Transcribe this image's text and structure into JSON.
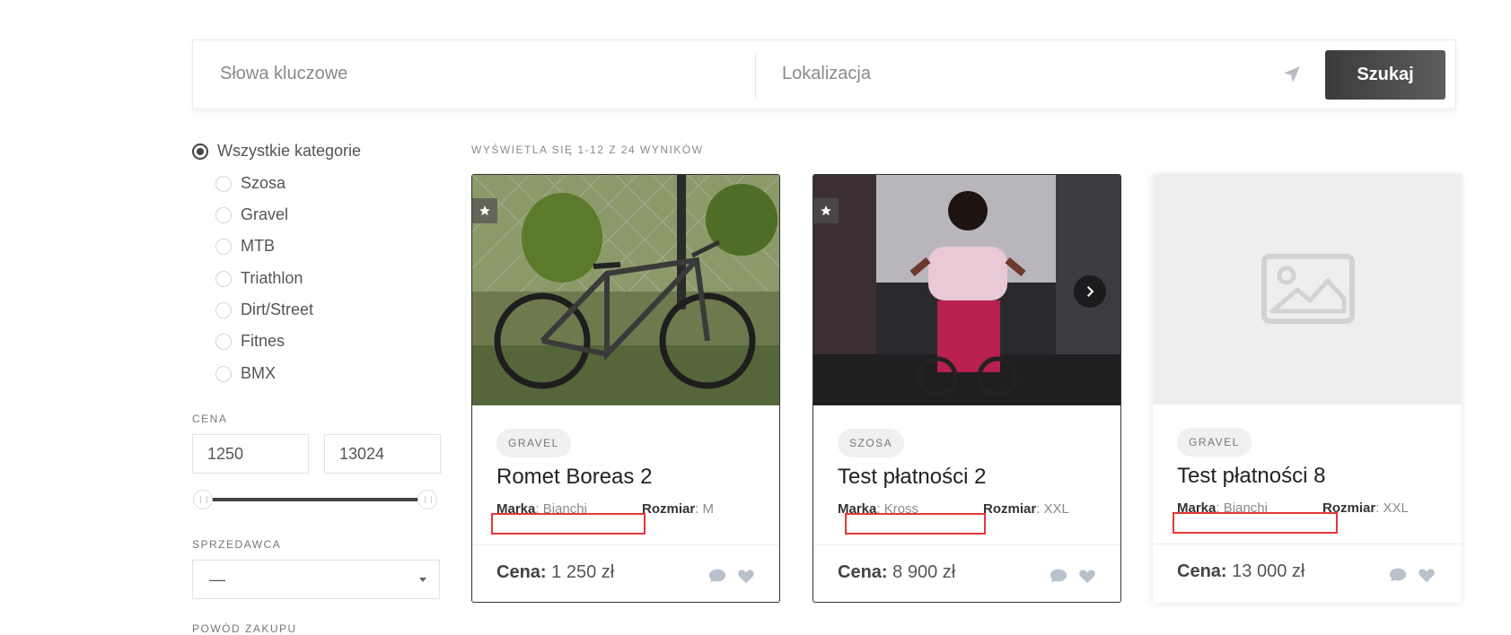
{
  "search": {
    "keywords_placeholder": "Słowa kluczowe",
    "location_placeholder": "Lokalizacja",
    "button": "Szukaj"
  },
  "sidebar": {
    "categories": [
      {
        "label": "Wszystkie kategorie",
        "checked": true
      },
      {
        "label": "Szosa",
        "checked": false
      },
      {
        "label": "Gravel",
        "checked": false
      },
      {
        "label": "MTB",
        "checked": false
      },
      {
        "label": "Triathlon",
        "checked": false
      },
      {
        "label": "Dirt/Street",
        "checked": false
      },
      {
        "label": "Fitnes",
        "checked": false
      },
      {
        "label": "BMX",
        "checked": false
      }
    ],
    "price": {
      "label": "CENA",
      "min": "1250",
      "max": "13024"
    },
    "seller": {
      "label": "SPRZEDAWCA",
      "value": "—"
    },
    "next_label": "POWÓD ZAKUPU"
  },
  "results": {
    "info": "WYŚWIETLA SIĘ 1-12 Z 24 WYNIKÓW",
    "cards": [
      {
        "category": "GRAVEL",
        "title": "Romet Boreas 2",
        "brand_label": "Marka",
        "brand": "Bianchi",
        "size_label": "Rozmiar",
        "size": "M",
        "price_label": "Cena:",
        "price": "1 250 zł"
      },
      {
        "category": "SZOSA",
        "title": "Test płatności 2",
        "brand_label": "Marka",
        "brand": "Kross",
        "size_label": "Rozmiar",
        "size": "XXL",
        "price_label": "Cena:",
        "price": "8 900 zł"
      },
      {
        "category": "GRAVEL",
        "title": "Test płatności 8",
        "brand_label": "Marka",
        "brand": "Bianchi",
        "size_label": "Rozmiar",
        "size": "XXL",
        "price_label": "Cena:",
        "price": "13 000 zł"
      }
    ]
  },
  "colors": {
    "accent_dark": "#444444",
    "highlight_red": "#e53935"
  }
}
